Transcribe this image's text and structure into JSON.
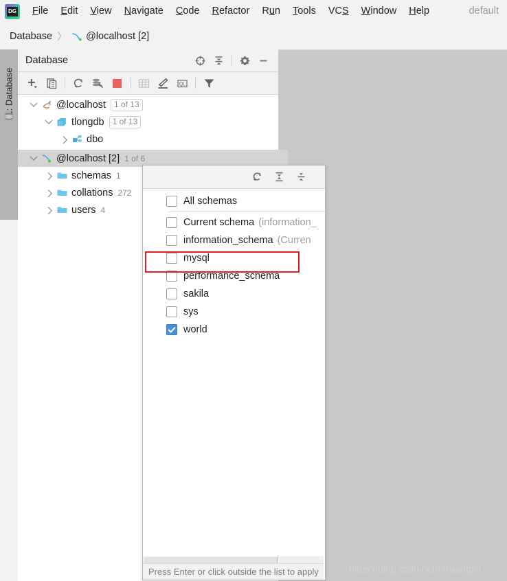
{
  "menu": {
    "logo_text": "DG",
    "items": [
      {
        "label": "File",
        "mnemonic": "F"
      },
      {
        "label": "Edit",
        "mnemonic": "E"
      },
      {
        "label": "View",
        "mnemonic": "V"
      },
      {
        "label": "Navigate",
        "mnemonic": "N"
      },
      {
        "label": "Code",
        "mnemonic": "C"
      },
      {
        "label": "Refactor",
        "mnemonic": "R"
      },
      {
        "label": "Run",
        "mnemonic": "u"
      },
      {
        "label": "Tools",
        "mnemonic": "T"
      },
      {
        "label": "VCS",
        "mnemonic": "S"
      },
      {
        "label": "Window",
        "mnemonic": "W"
      },
      {
        "label": "Help",
        "mnemonic": "H"
      }
    ],
    "right_label": "default"
  },
  "breadcrumb": {
    "root": "Database",
    "separator": "〉",
    "current": "@localhost [2]"
  },
  "tool_stripe": {
    "label": "1: Database",
    "icon": "database-icon"
  },
  "db_panel": {
    "title": "Database",
    "header_icons": [
      {
        "name": "locate-target-icon",
        "glyph": "target"
      },
      {
        "name": "collapse-all-icon",
        "glyph": "collapse"
      },
      {
        "name": "settings-gear-icon",
        "glyph": "gear"
      },
      {
        "name": "hide-panel-icon",
        "glyph": "minus"
      }
    ],
    "toolbar_icons": [
      {
        "name": "add-data-source-icon",
        "glyph": "plus"
      },
      {
        "name": "duplicate-icon",
        "glyph": "copy"
      },
      {
        "name": "refresh-icon",
        "glyph": "refresh"
      },
      {
        "name": "run-sql-script-icon",
        "glyph": "sqlscript"
      },
      {
        "name": "stop-icon",
        "glyph": "stop"
      },
      {
        "name": "table-editor-icon",
        "glyph": "table"
      },
      {
        "name": "modify-icon",
        "glyph": "pencil"
      },
      {
        "name": "open-console-icon",
        "glyph": "ql"
      },
      {
        "name": "filter-icon",
        "glyph": "filter"
      }
    ]
  },
  "tree": {
    "group1": [
      {
        "label": "@localhost",
        "badge": "1 of 13",
        "icon": "sqlserver-icon",
        "expanded": true,
        "indent": 0
      },
      {
        "label": "tlongdb",
        "badge": "1 of 13",
        "icon": "database-stack-icon",
        "expanded": true,
        "indent": 1
      },
      {
        "label": "dbo",
        "badge": "",
        "icon": "schema-icon",
        "expanded": false,
        "indent": 2
      }
    ],
    "selected_node": {
      "label": "@localhost [2]",
      "badge": "1 of 6",
      "icon": "mysql-dolphin-icon",
      "expanded": true
    },
    "group2": [
      {
        "label": "schemas",
        "count": "1",
        "icon": "folder-icon",
        "expanded": false
      },
      {
        "label": "collations",
        "count": "272",
        "icon": "folder-icon",
        "expanded": false
      },
      {
        "label": "users",
        "count": "4",
        "icon": "folder-icon",
        "expanded": false
      }
    ]
  },
  "popup": {
    "toolbar_icons": [
      {
        "name": "refresh-icon",
        "glyph": "refresh"
      },
      {
        "name": "expand-all-icon",
        "glyph": "expand"
      },
      {
        "name": "collapse-all-icon",
        "glyph": "collapse"
      }
    ],
    "items": [
      {
        "label": "All schemas",
        "note": "",
        "checked": false,
        "highlighted": false
      },
      {
        "label": "Current schema",
        "note": "(information_",
        "checked": false,
        "highlighted": false
      },
      {
        "label": "information_schema",
        "note": "(Curren",
        "checked": false,
        "highlighted": true
      },
      {
        "label": "mysql",
        "note": "",
        "checked": false,
        "highlighted": false
      },
      {
        "label": "performance_schema",
        "note": "",
        "checked": false,
        "highlighted": false
      },
      {
        "label": "sakila",
        "note": "",
        "checked": false,
        "highlighted": false
      },
      {
        "label": "sys",
        "note": "",
        "checked": false,
        "highlighted": false
      },
      {
        "label": "world",
        "note": "",
        "checked": true,
        "highlighted": false
      }
    ],
    "status_text": "Press Enter or click outside the list to apply"
  },
  "watermark": "https://blog.csdn.net/fanjianglin",
  "colors": {
    "accent_checkbox": "#4a90d9",
    "highlight_box": "#e02020",
    "panel_bg": "#f2f2f2",
    "desktop_bg": "#c8c8c8",
    "selection": "#d4d4d4",
    "stop_red": "#e8615e",
    "folder_blue": "#6fc5ea"
  }
}
